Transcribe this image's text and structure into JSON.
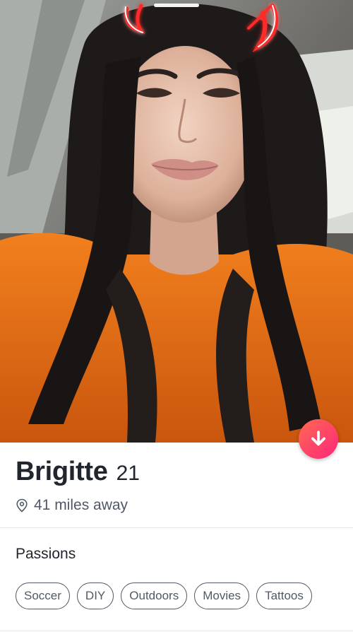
{
  "profile": {
    "name": "Brigitte",
    "age": "21",
    "distance": "41 miles away",
    "passions_title": "Passions",
    "passions": [
      "Soccer",
      "DIY",
      "Outdoors",
      "Movies",
      "Tattoos"
    ]
  },
  "icons": {
    "location": "location-pin-icon",
    "collapse": "arrow-down-icon"
  },
  "colors": {
    "accent_start": "#ff6a52",
    "accent_end": "#fd267a",
    "text_primary": "#21262e",
    "text_secondary": "#505965",
    "filter_horns": "#ff2a2a"
  }
}
